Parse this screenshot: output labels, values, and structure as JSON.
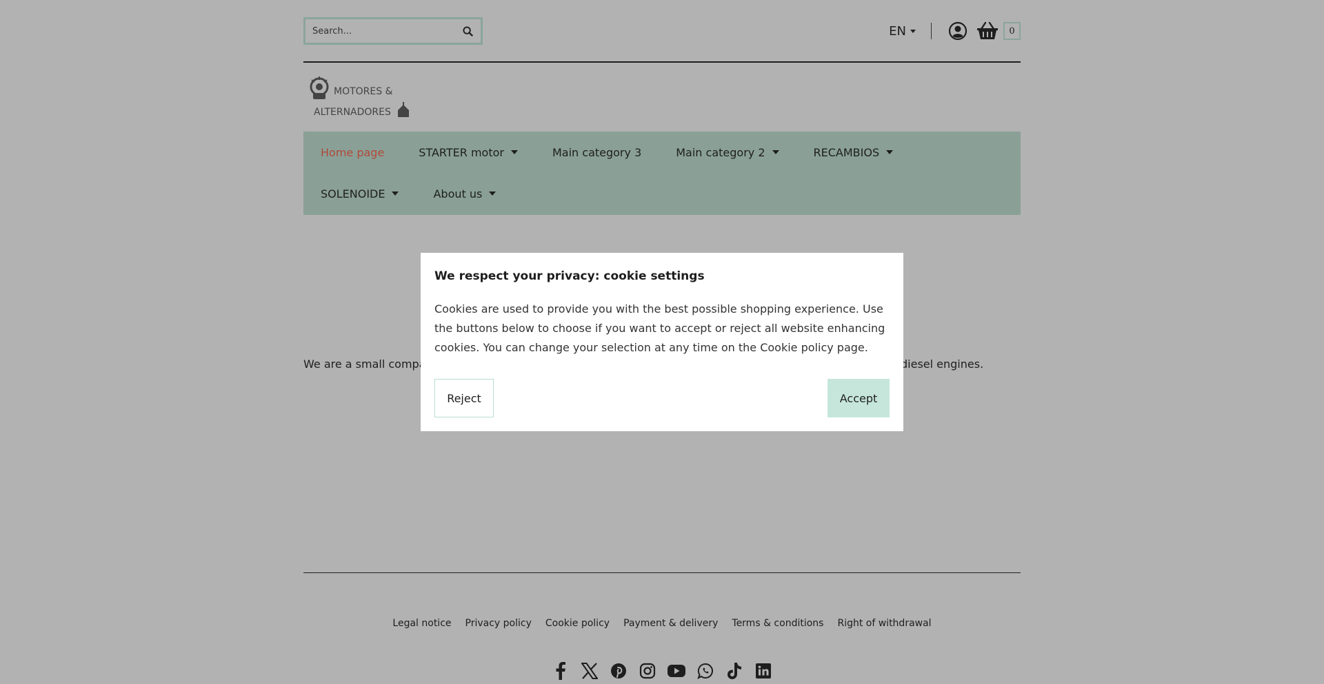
{
  "header": {
    "search_placeholder": "Search...",
    "language": "EN",
    "cart_count": "0"
  },
  "logo": {
    "line1": "MOTORES &",
    "line2": "ALTERNADORES"
  },
  "nav": {
    "items": [
      {
        "label": "Home page",
        "active": true,
        "dropdown": false
      },
      {
        "label": "STARTER motor",
        "active": false,
        "dropdown": true
      },
      {
        "label": "Main category 3",
        "active": false,
        "dropdown": false
      },
      {
        "label": "Main category 2",
        "active": false,
        "dropdown": true
      },
      {
        "label": "RECAMBIOS",
        "active": false,
        "dropdown": true
      },
      {
        "label": "SOLENOIDE",
        "active": false,
        "dropdown": true
      },
      {
        "label": "About us",
        "active": false,
        "dropdown": true
      }
    ]
  },
  "main": {
    "intro_left": "We are a small compar",
    "intro_right": "diesel engines."
  },
  "footer": {
    "links": [
      "Legal notice",
      "Privacy policy",
      "Cookie policy",
      "Payment & delivery",
      "Terms & conditions",
      "Right of withdrawal"
    ],
    "socials": [
      "facebook-icon",
      "x-icon",
      "pinterest-icon",
      "instagram-icon",
      "youtube-icon",
      "whatsapp-icon",
      "tiktok-icon",
      "linkedin-icon"
    ]
  },
  "cookie_modal": {
    "title": "We respect your privacy: cookie settings",
    "body": "Cookies are used to provide you with the best possible shopping experience. Use the buttons below to choose if you want to accept or reject all website enhancing cookies. You can change your selection at any time on the Cookie policy page.",
    "reject_label": "Reject",
    "accept_label": "Accept"
  },
  "colors": {
    "background": "#b2b2b2",
    "nav_bg": "#8aa097",
    "active_nav": "#b04a3a",
    "accept_bg": "#c6e6dc"
  }
}
